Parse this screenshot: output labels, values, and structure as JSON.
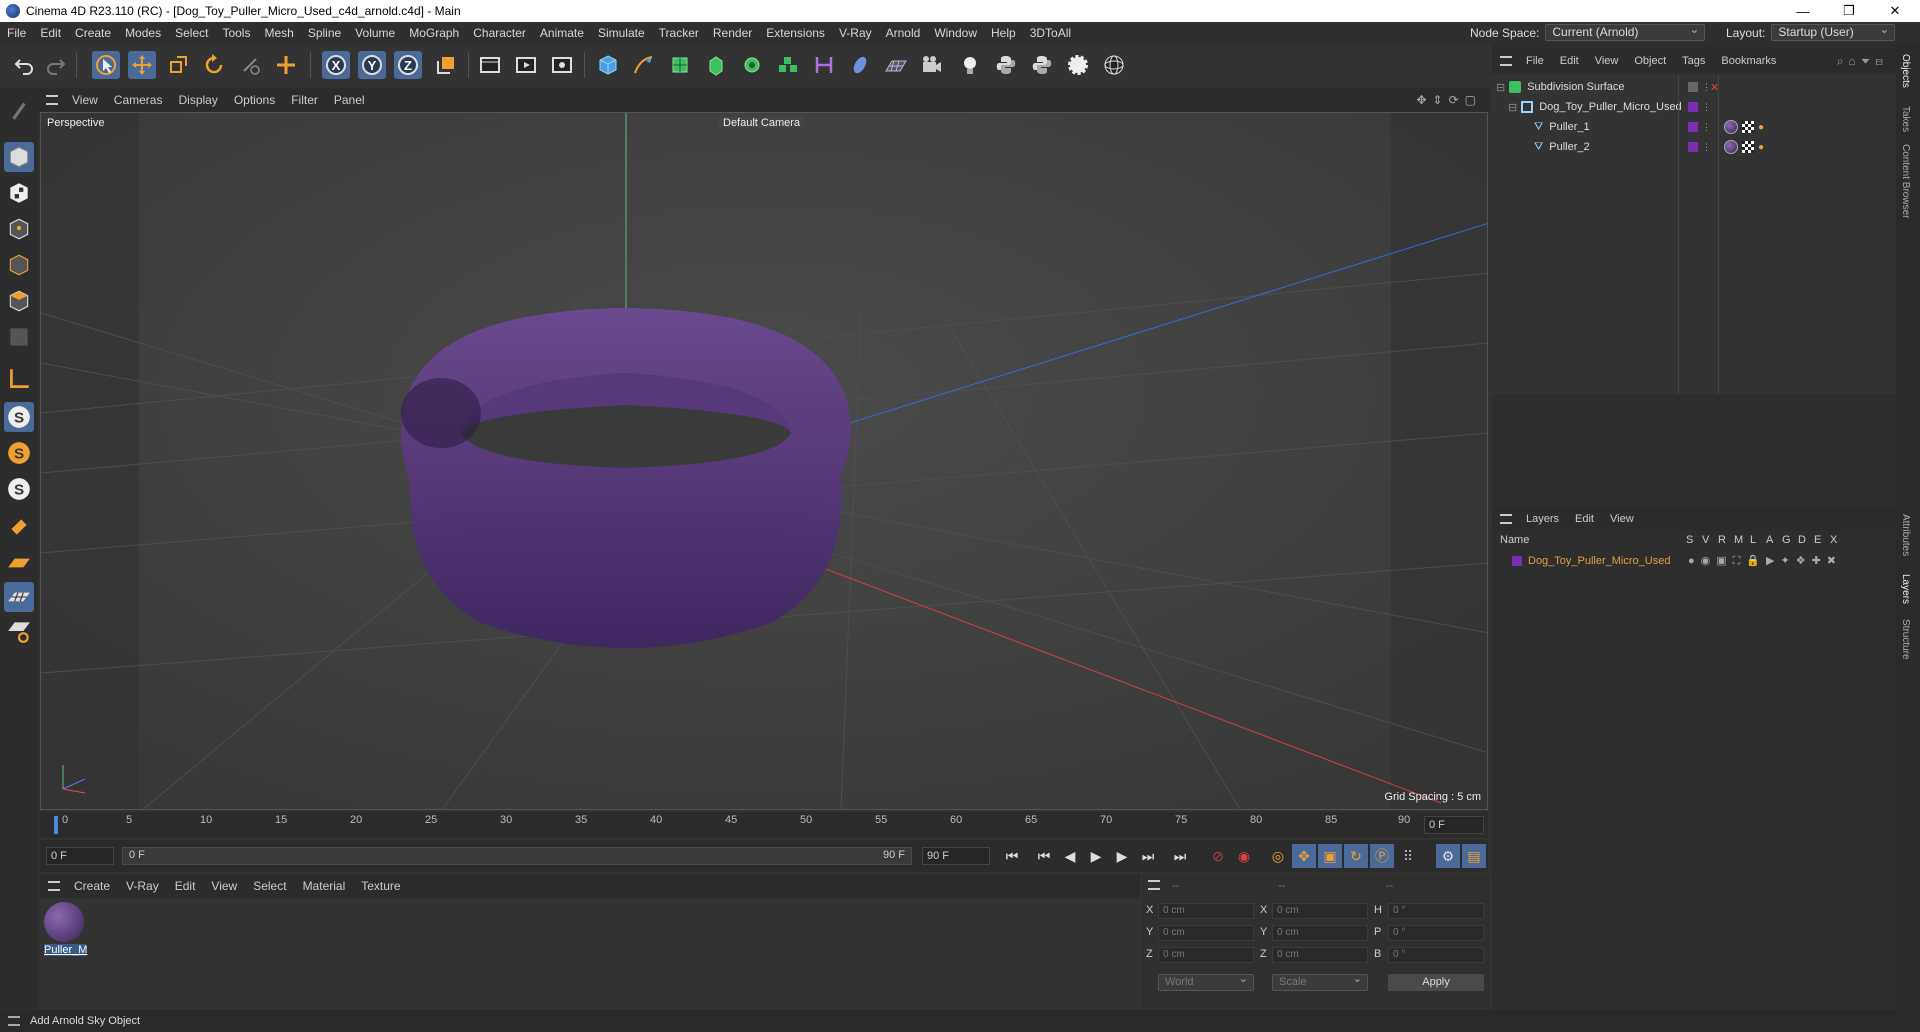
{
  "window": {
    "title": "Cinema 4D R23.110 (RC) - [Dog_Toy_Puller_Micro_Used_c4d_arnold.c4d] - Main",
    "controls": [
      "—",
      "❐",
      "✕"
    ]
  },
  "menubar": {
    "items": [
      "File",
      "Edit",
      "Create",
      "Modes",
      "Select",
      "Tools",
      "Mesh",
      "Spline",
      "Volume",
      "MoGraph",
      "Character",
      "Animate",
      "Simulate",
      "Tracker",
      "Render",
      "Extensions",
      "V-Ray",
      "Arnold",
      "Window",
      "Help",
      "3DToAll"
    ],
    "node_space_label": "Node Space:",
    "node_space_value": "Current (Arnold)",
    "layout_label": "Layout:",
    "layout_value": "Startup (User)"
  },
  "viewport": {
    "menu": [
      "View",
      "Cameras",
      "Display",
      "Options",
      "Filter",
      "Panel"
    ],
    "label": "Perspective",
    "camera": "Default Camera",
    "grid_spacing": "Grid Spacing : 5 cm",
    "object_color": "#5a3a80"
  },
  "timeline": {
    "ticks": [
      "0",
      "5",
      "10",
      "15",
      "20",
      "25",
      "30",
      "35",
      "40",
      "45",
      "50",
      "55",
      "60",
      "65",
      "70",
      "75",
      "80",
      "85",
      "90"
    ],
    "current_frame": "0 F"
  },
  "transport": {
    "start_field": "0 F",
    "range_start": "0 F",
    "range_end": "90 F",
    "end_field": "90 F"
  },
  "material_manager": {
    "menu": [
      "Create",
      "V-Ray",
      "Edit",
      "View",
      "Select",
      "Material",
      "Texture"
    ],
    "materials": [
      {
        "name": "Puller_M"
      }
    ]
  },
  "coordinates": {
    "header": [
      "--",
      "--",
      "--"
    ],
    "rows": [
      {
        "l1": "X",
        "v1": "0 cm",
        "l2": "X",
        "v2": "0 cm",
        "l3": "H",
        "v3": "0 °"
      },
      {
        "l1": "Y",
        "v1": "0 cm",
        "l2": "Y",
        "v2": "0 cm",
        "l3": "P",
        "v3": "0 °"
      },
      {
        "l1": "Z",
        "v1": "0 cm",
        "l2": "Z",
        "v2": "0 cm",
        "l3": "B",
        "v3": "0 °"
      }
    ],
    "mode": "World",
    "transform": "Scale",
    "apply": "Apply"
  },
  "object_manager": {
    "menu": [
      "File",
      "Edit",
      "View",
      "Object",
      "Tags",
      "Bookmarks"
    ],
    "objects": [
      {
        "name": "Subdivision Surface",
        "indent": 0
      },
      {
        "name": "Dog_Toy_Puller_Micro_Used",
        "indent": 1
      },
      {
        "name": "Puller_1",
        "indent": 2
      },
      {
        "name": "Puller_2",
        "indent": 2
      }
    ]
  },
  "layer_manager": {
    "menu": [
      "Layers",
      "Edit",
      "View"
    ],
    "columns": [
      "Name",
      "S",
      "V",
      "R",
      "M",
      "L",
      "A",
      "G",
      "D",
      "E",
      "X"
    ],
    "layers": [
      {
        "name": "Dog_Toy_Puller_Micro_Used",
        "color": "#7a2fb0"
      }
    ]
  },
  "side_tabs": [
    "Objects",
    "Takes",
    "Content Browser",
    "Attributes",
    "Layers",
    "Structure"
  ],
  "status": {
    "text": "Add Arnold Sky Object"
  },
  "colors": {
    "accent": "#4a6a9a",
    "layer_text": "#e0a040",
    "purple": "#7a2fb0"
  }
}
